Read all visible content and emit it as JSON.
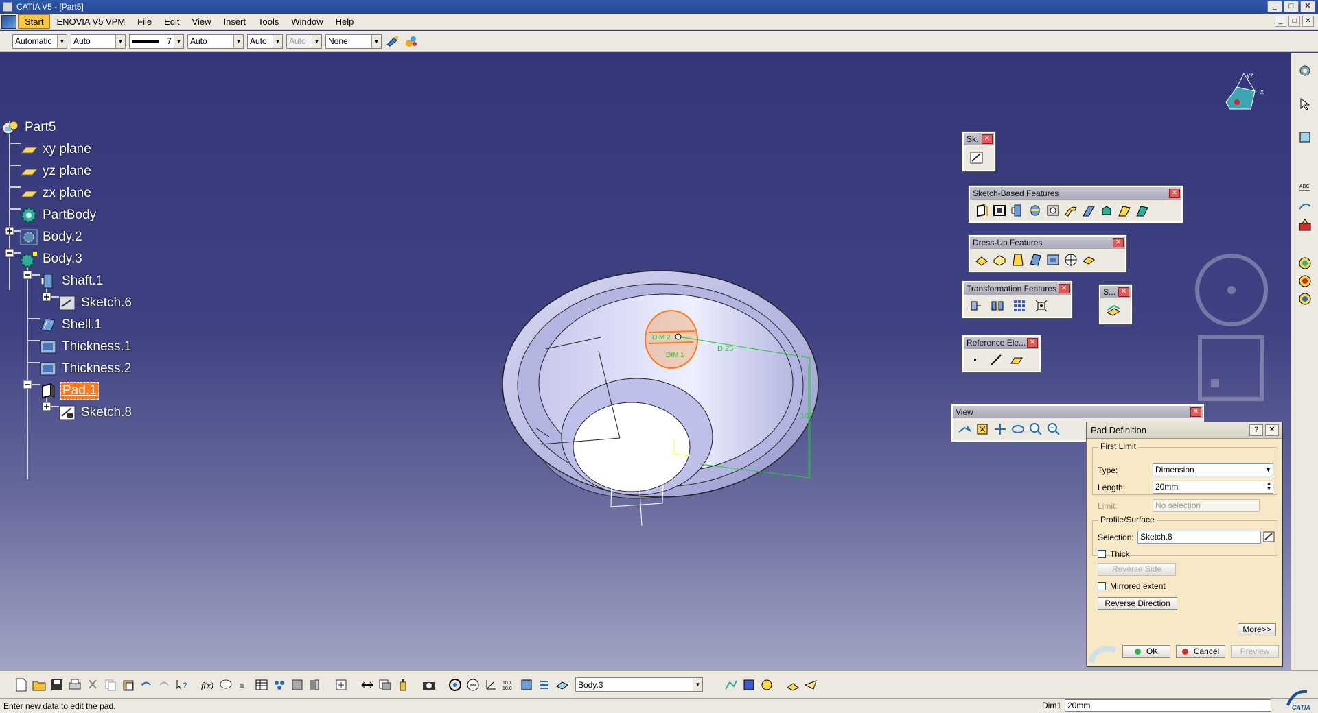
{
  "window": {
    "title": "CATIA V5 - [Part5]",
    "controls": [
      "_",
      "□",
      "✕"
    ],
    "mdi_controls": [
      "_",
      "□",
      "✕"
    ]
  },
  "menu": {
    "items": [
      "Start",
      "ENOVIA V5 VPM",
      "File",
      "Edit",
      "View",
      "Insert",
      "Tools",
      "Window",
      "Help"
    ]
  },
  "graphic_properties": {
    "color": "Automatic",
    "transparency": "Auto",
    "line_weight": "7",
    "line_type": "Auto",
    "point_type": "Auto",
    "layer_auto": "Auto",
    "layer": "None"
  },
  "tree": {
    "nodes": [
      {
        "label": "Part5",
        "icon": "part-icon"
      },
      {
        "label": "xy plane",
        "icon": "plane-icon"
      },
      {
        "label": "yz plane",
        "icon": "plane-icon"
      },
      {
        "label": "zx plane",
        "icon": "plane-icon"
      },
      {
        "label": "PartBody",
        "icon": "body-icon"
      },
      {
        "label": "Body.2",
        "icon": "body-icon"
      },
      {
        "label": "Body.3",
        "icon": "body-icon"
      },
      {
        "label": "Shaft.1",
        "icon": "shaft-icon"
      },
      {
        "label": "Sketch.6",
        "icon": "sketch-icon"
      },
      {
        "label": "Shell.1",
        "icon": "shell-icon"
      },
      {
        "label": "Thickness.1",
        "icon": "thickness-icon"
      },
      {
        "label": "Thickness.2",
        "icon": "thickness-icon"
      },
      {
        "label": "Pad.1",
        "icon": "pad-icon"
      },
      {
        "label": "Sketch.8",
        "icon": "sketch-icon"
      }
    ]
  },
  "toolbars": {
    "sketcher": "Sk.",
    "sketch_based": "Sketch-Based Features",
    "dress_up": "Dress-Up Features",
    "transformation": "Transformation Features",
    "surface": "S...",
    "reference": "Reference Ele...",
    "view": "View"
  },
  "viewport_labels": {
    "dim1": "DIM 1",
    "dim2": "DIM 2",
    "d25": "D 25",
    "d102": "102"
  },
  "pad_dialog": {
    "title": "Pad Definition",
    "first_limit": "First Limit",
    "type_label": "Type:",
    "type_value": "Dimension",
    "length_label": "Length:",
    "length_value": "20mm",
    "limit_label": "Limit:",
    "limit_value": "No selection",
    "profile_surface": "Profile/Surface",
    "selection_label": "Selection:",
    "selection_value": "Sketch.8",
    "thick_label": "Thick",
    "reverse_side": "Reverse Side",
    "mirrored_extent": "Mirrored extent",
    "reverse_direction": "Reverse Direction",
    "more": "More>>",
    "ok": "OK",
    "cancel": "Cancel",
    "preview": "Preview"
  },
  "bottom_toolbar": {
    "current_body": "Body.3"
  },
  "status": {
    "message": "Enter new data to edit the pad.",
    "dim_label": "Dim1",
    "dim_value": "20mm"
  },
  "colors": {
    "viewport_top": "#333779",
    "viewport_bottom": "#a2a4c5",
    "selection": "#ff7a1c",
    "dialog_bg": "#f7e8c6",
    "toolbar_bg": "#ece9e1"
  }
}
